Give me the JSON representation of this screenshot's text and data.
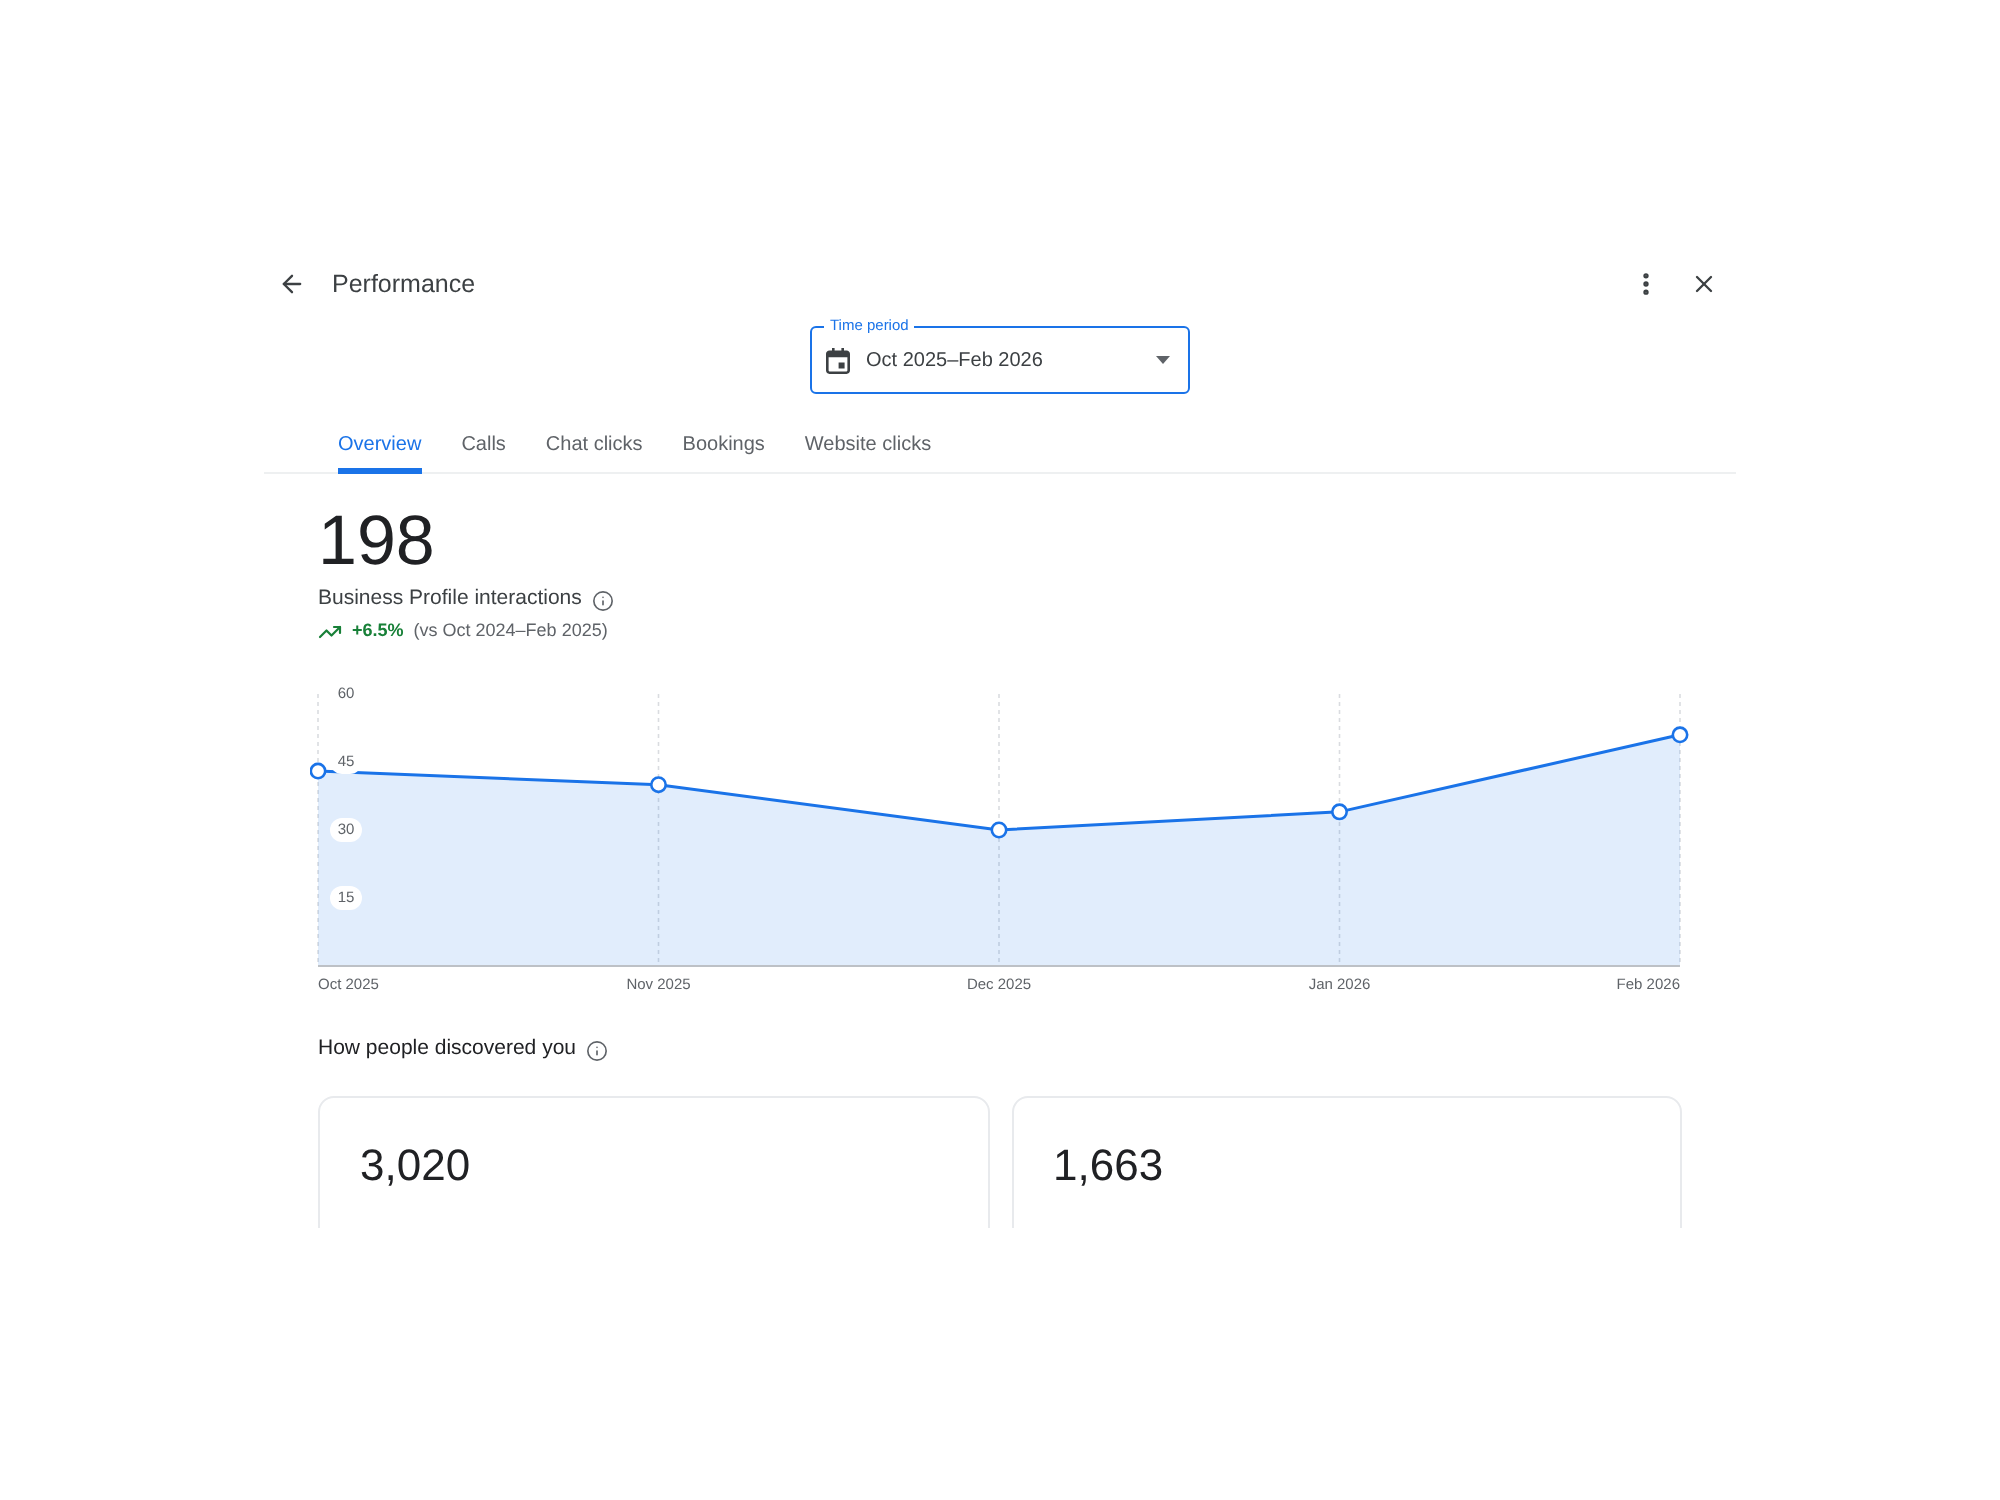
{
  "header": {
    "title": "Performance"
  },
  "time_period": {
    "label": "Time period",
    "value": "Oct 2025–Feb 2026"
  },
  "tabs": [
    {
      "label": "Overview",
      "selected": true
    },
    {
      "label": "Calls",
      "selected": false
    },
    {
      "label": "Chat clicks",
      "selected": false
    },
    {
      "label": "Bookings",
      "selected": false
    },
    {
      "label": "Website clicks",
      "selected": false
    }
  ],
  "summary": {
    "value": "198",
    "label": "Business Profile interactions",
    "increase": true,
    "change": "+6.5%",
    "comparison": "(vs Oct 2024–Feb 2025)"
  },
  "interactions_chart": {
    "chart_data": {
      "type": "area",
      "categories": [
        "Oct 2025",
        "Nov 2025",
        "Dec 2025",
        "Jan 2026",
        "Feb 2026"
      ],
      "series": [
        {
          "color": "#1a73e8",
          "values": [
            43,
            40,
            30,
            34,
            51
          ]
        }
      ],
      "ylim": [
        0,
        60
      ],
      "yticks": [
        15,
        30,
        45,
        60
      ],
      "grid": true
    }
  },
  "discovery": {
    "title": "How people discovered you",
    "cards": [
      {
        "value": "3,020"
      },
      {
        "value": "1,663"
      }
    ]
  }
}
